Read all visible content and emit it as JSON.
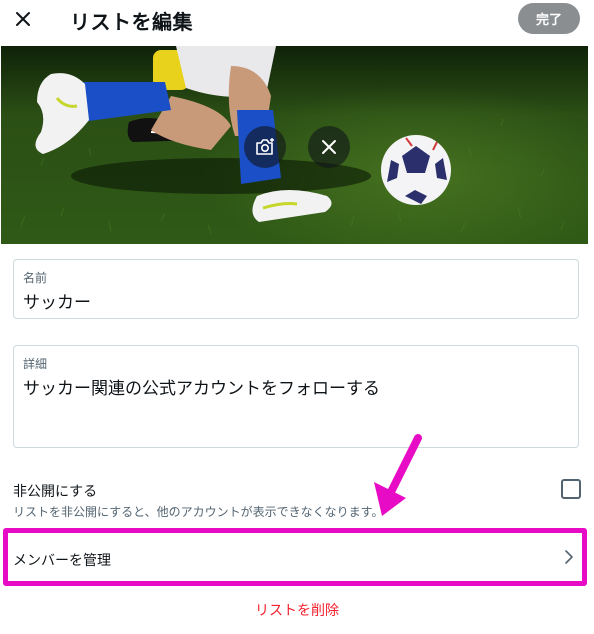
{
  "header": {
    "close_icon": "close-icon",
    "title": "リストを編集",
    "done_label": "完了"
  },
  "banner": {
    "image": "soccer-player-kicking-ball-on-grass",
    "camera_icon": "add-photo-icon",
    "remove_icon": "close-icon"
  },
  "form": {
    "name": {
      "label": "名前",
      "value": "サッカー"
    },
    "description": {
      "label": "詳細",
      "value": "サッカー関連の公式アカウントをフォローする"
    }
  },
  "private": {
    "label": "非公開にする",
    "description": "リストを非公開にすると、他のアカウントが表示できなくなります。",
    "checked": false
  },
  "manage": {
    "label": "メンバーを管理",
    "chevron_icon": "chevron-right-icon"
  },
  "delete": {
    "label": "リストを削除"
  },
  "annotation": {
    "color": "#e80bc5"
  },
  "colors": {
    "done_button": "#8b8e91",
    "delete_text": "#f4212e",
    "border": "#cfd9de",
    "secondary_text": "#536471"
  }
}
